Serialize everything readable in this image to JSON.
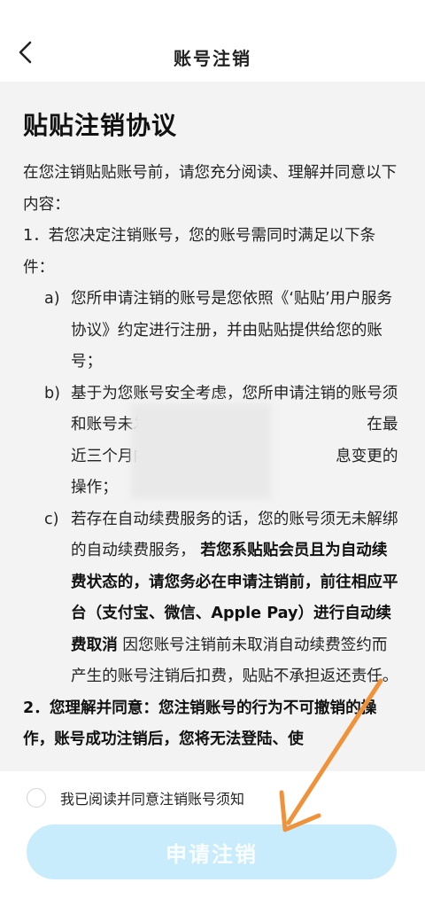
{
  "nav": {
    "title": "账号注销"
  },
  "document": {
    "title": "贴贴注销协议",
    "intro": "在您注销贴贴账号前，请您充分阅读、理解并同意以下内容：",
    "clause1": "1．若您决定注销账号，您的账号需同时满足以下条件：",
    "items": {
      "a_mark": "a)",
      "a_text": "您所申请注销的账号是您依照《‘贴贴’用户服务协议》约定进行注册，并由贴贴提供给您的账号；",
      "b_mark": "b)",
      "b_text": "基于为您账号安全考虑，您所申请注销的账号须　　　　　　　　和账号未发生过被盗、被　　　　　　　　在最近三个月内未进行换　　　　　　　　息变更的操作；",
      "c_mark": "c)",
      "c_text1": "若存在自动续费服务的话，您的账号须无未解绑的自动续费服务，",
      "c_bold": "若您系贴贴会员且为自动续费状态的，请您务必在申请注销前，前往相应平台（支付宝、微信、Apple Pay）进行自动续费取消",
      "c_text2": "因您账号注销前未取消自动续费签约而产生的账号注销后扣费，贴贴不承担返还责任。"
    },
    "clause2": "2．您理解并同意：您注销账号的行为不可撤销的操作，账号成功注销后，您将无法登陆、使"
  },
  "footer": {
    "agree_label": "我已阅读并同意注销账号须知",
    "apply_button": "申请注销"
  },
  "colors": {
    "accent_button": "#c9ecfc",
    "annotation_arrow": "#f0923a"
  }
}
